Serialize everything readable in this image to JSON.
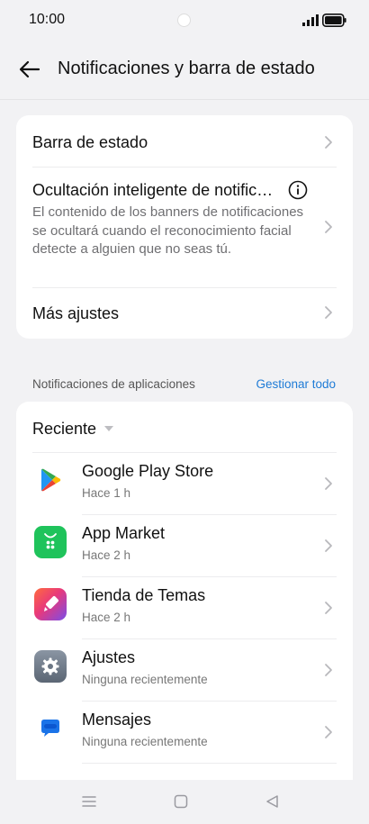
{
  "status_bar": {
    "time": "10:00"
  },
  "header": {
    "title": "Notificaciones y barra de estado"
  },
  "settings": {
    "status_bar_label": "Barra de estado",
    "smart_hide_title": "Ocultación inteligente de notific…",
    "smart_hide_desc": "El contenido de los banners de notificaciones se ocultará cuando el reconocimiento facial detecte a alguien que no seas tú.",
    "more_settings": "Más ajustes"
  },
  "app_notifications": {
    "section_label": "Notificaciones de aplicaciones",
    "manage_all": "Gestionar todo",
    "sort_label": "Reciente",
    "apps": [
      {
        "name": "Google Play Store",
        "subtitle": "Hace 1 h",
        "icon": "google-play-icon"
      },
      {
        "name": "App Market",
        "subtitle": "Hace 2 h",
        "icon": "app-market-icon"
      },
      {
        "name": "Tienda de Temas",
        "subtitle": "Hace 2 h",
        "icon": "theme-store-icon"
      },
      {
        "name": "Ajustes",
        "subtitle": "Ninguna recientemente",
        "icon": "settings-gear-icon"
      },
      {
        "name": "Mensajes",
        "subtitle": "Ninguna recientemente",
        "icon": "messages-icon"
      }
    ]
  },
  "colors": {
    "accent": "#1e7bd6",
    "background": "#f2f2f4",
    "card": "#ffffff"
  }
}
